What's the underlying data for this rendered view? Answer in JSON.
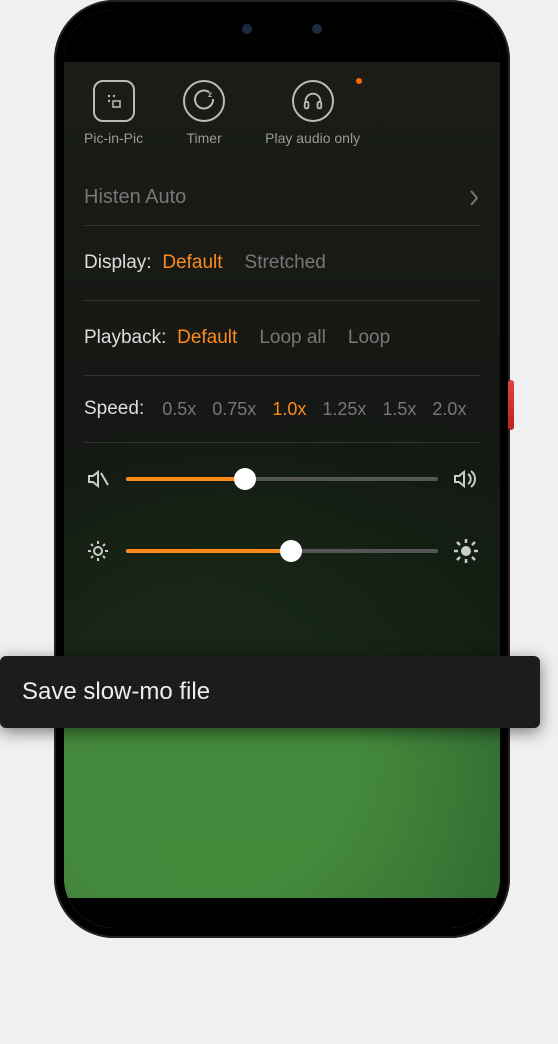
{
  "topButtons": [
    {
      "id": "pip",
      "label": "Pic-in-Pic",
      "icon": "pip-icon"
    },
    {
      "id": "timer",
      "label": "Timer",
      "icon": "timer-icon"
    },
    {
      "id": "audio",
      "label": "Play audio only",
      "icon": "headphones-icon",
      "dot": true
    }
  ],
  "listRow": {
    "label": "Histen Auto"
  },
  "display": {
    "label": "Display:",
    "options": [
      "Default",
      "Stretched"
    ],
    "selected": "Default"
  },
  "playback": {
    "label": "Playback:",
    "options": [
      "Default",
      "Loop all",
      "Loop"
    ],
    "selected": "Default"
  },
  "speed": {
    "label": "Speed:",
    "options": [
      "0.5x",
      "0.75x",
      "1.0x",
      "1.25x",
      "1.5x",
      "2.0x"
    ],
    "selected": "1.0x"
  },
  "volumeSlider": {
    "percent": 38
  },
  "brightnessSlider": {
    "percent": 53
  },
  "toast": {
    "text": "Save slow-mo file"
  },
  "accent": "#ff8a1a"
}
